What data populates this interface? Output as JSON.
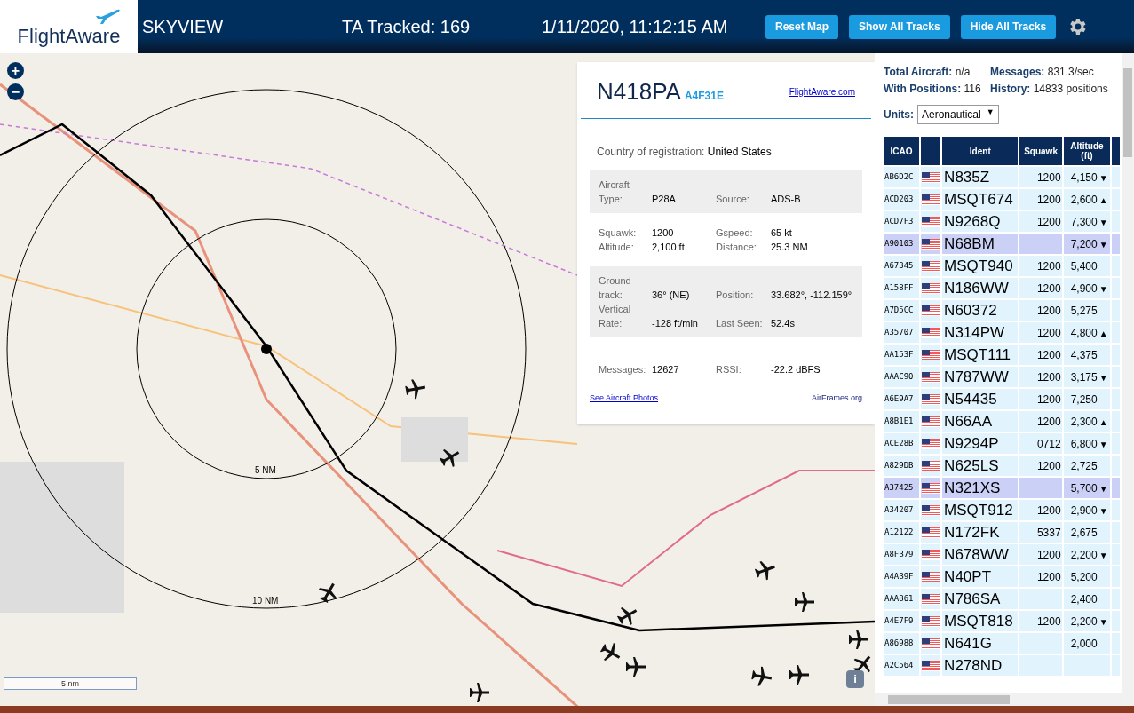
{
  "header": {
    "logo": "FlightAware",
    "title": "SKYVIEW",
    "tracked": "TA Tracked: 169",
    "datetime": "1/11/2020, 11:12:15 AM",
    "buttons": [
      "Reset Map",
      "Show All Tracks",
      "Hide All Tracks"
    ]
  },
  "map": {
    "zoom_in": "+",
    "zoom_out": "−",
    "range_labels": [
      "5 NM",
      "10 NM"
    ],
    "scale": "5 nm",
    "info": "i"
  },
  "popup": {
    "ident": "N418PA",
    "icao": "A4F31E",
    "link": "FlightAware.com",
    "country_label": "Country of registration:",
    "country": "United States",
    "sections": [
      {
        "shaded": true,
        "fields": [
          {
            "label": "Aircraft Type:",
            "value": "P28A"
          },
          {
            "label": "Source:",
            "value": "ADS-B"
          }
        ]
      },
      {
        "shaded": false,
        "fields": [
          {
            "label": "Squawk:",
            "value": "1200"
          },
          {
            "label": "Gspeed:",
            "value": "65 kt"
          },
          {
            "label": "Altitude:",
            "value": "2,100 ft"
          },
          {
            "label": "Distance:",
            "value": "25.3 NM"
          }
        ]
      },
      {
        "shaded": true,
        "fields": [
          {
            "label": "Ground track:",
            "value": "36° (NE)"
          },
          {
            "label": "Position:",
            "value": "33.682°, -112.159°"
          },
          {
            "label": "Vertical Rate:",
            "value": "-128 ft/min"
          },
          {
            "label": "Last Seen:",
            "value": "52.4s"
          }
        ]
      },
      {
        "shaded": false,
        "fields": [
          {
            "label": "Messages:",
            "value": "12627"
          },
          {
            "label": "RSSI:",
            "value": "-22.2 dBFS"
          }
        ]
      }
    ],
    "photos_link": "See Aircraft Photos",
    "airframes_link": "AirFrames.org"
  },
  "stats": [
    {
      "label": "Total Aircraft:",
      "value": "n/a"
    },
    {
      "label": "Messages:",
      "value": "831.3/sec"
    },
    {
      "label": "With Positions:",
      "value": "116"
    },
    {
      "label": "History:",
      "value": "14833 positions"
    }
  ],
  "units": {
    "label": "Units:",
    "value": "Aeronautical",
    "caret": "▼"
  },
  "table": {
    "columns": [
      "ICAO",
      "",
      "Ident",
      "Squawk",
      "Altitude (ft)"
    ],
    "rows": [
      {
        "icao": "AB6D2C",
        "ident": "N835Z",
        "squawk": "1200",
        "altitude": "4,150",
        "trend": "▼",
        "selected": false
      },
      {
        "icao": "ACD203",
        "ident": "MSQT674",
        "squawk": "1200",
        "altitude": "2,600",
        "trend": "▲",
        "selected": false
      },
      {
        "icao": "ACD7F3",
        "ident": "N9268Q",
        "squawk": "1200",
        "altitude": "7,300",
        "trend": "▼",
        "selected": false
      },
      {
        "icao": "A90103",
        "ident": "N68BM",
        "squawk": "",
        "altitude": "7,200",
        "trend": "▼",
        "selected": true
      },
      {
        "icao": "A67345",
        "ident": "MSQT940",
        "squawk": "1200",
        "altitude": "5,400",
        "trend": "",
        "selected": false
      },
      {
        "icao": "A158FF",
        "ident": "N186WW",
        "squawk": "1200",
        "altitude": "4,900",
        "trend": "▼",
        "selected": false
      },
      {
        "icao": "A7D5CC",
        "ident": "N60372",
        "squawk": "1200",
        "altitude": "5,275",
        "trend": "",
        "selected": false
      },
      {
        "icao": "A35707",
        "ident": "N314PW",
        "squawk": "1200",
        "altitude": "4,800",
        "trend": "▲",
        "selected": false
      },
      {
        "icao": "AA153F",
        "ident": "MSQT111",
        "squawk": "1200",
        "altitude": "4,375",
        "trend": "",
        "selected": false
      },
      {
        "icao": "AAAC90",
        "ident": "N787WW",
        "squawk": "1200",
        "altitude": "3,175",
        "trend": "▼",
        "selected": false
      },
      {
        "icao": "A6E9A7",
        "ident": "N54435",
        "squawk": "1200",
        "altitude": "7,250",
        "trend": "",
        "selected": false
      },
      {
        "icao": "A8B1E1",
        "ident": "N66AA",
        "squawk": "1200",
        "altitude": "2,300",
        "trend": "▲",
        "selected": false
      },
      {
        "icao": "ACE28B",
        "ident": "N9294P",
        "squawk": "0712",
        "altitude": "6,800",
        "trend": "▼",
        "selected": false
      },
      {
        "icao": "A829DB",
        "ident": "N625LS",
        "squawk": "1200",
        "altitude": "2,725",
        "trend": "",
        "selected": false
      },
      {
        "icao": "A37425",
        "ident": "N321XS",
        "squawk": "",
        "altitude": "5,700",
        "trend": "▼",
        "selected": true
      },
      {
        "icao": "A34207",
        "ident": "MSQT912",
        "squawk": "1200",
        "altitude": "2,900",
        "trend": "▼",
        "selected": false
      },
      {
        "icao": "A12122",
        "ident": "N172FK",
        "squawk": "5337",
        "altitude": "2,675",
        "trend": "",
        "selected": false
      },
      {
        "icao": "A8FB79",
        "ident": "N678WW",
        "squawk": "1200",
        "altitude": "2,200",
        "trend": "▼",
        "selected": false
      },
      {
        "icao": "A4AB9F",
        "ident": "N40PT",
        "squawk": "1200",
        "altitude": "5,200",
        "trend": "",
        "selected": false
      },
      {
        "icao": "AAA861",
        "ident": "N786SA",
        "squawk": "",
        "altitude": "2,400",
        "trend": "",
        "selected": false
      },
      {
        "icao": "A4E7F9",
        "ident": "MSQT818",
        "squawk": "1200",
        "altitude": "2,200",
        "trend": "▼",
        "selected": false
      },
      {
        "icao": "A86988",
        "ident": "N641G",
        "squawk": "",
        "altitude": "2,000",
        "trend": "",
        "selected": false
      },
      {
        "icao": "A2C564",
        "ident": "N278ND",
        "squawk": "",
        "altitude": "",
        "trend": "",
        "selected": false
      }
    ]
  }
}
